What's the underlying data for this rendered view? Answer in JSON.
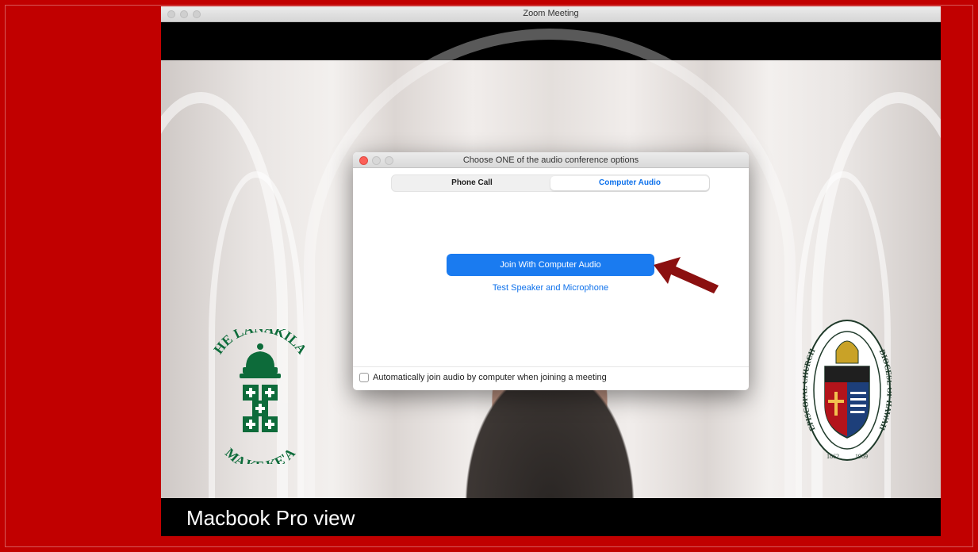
{
  "window": {
    "title": "Zoom Meeting"
  },
  "caption": "Macbook Pro view",
  "dialog": {
    "title": "Choose ONE of the audio conference options",
    "tabs": [
      {
        "label": "Phone Call",
        "selected": false
      },
      {
        "label": "Computer Audio",
        "selected": true
      }
    ],
    "join_button": "Join With Computer Audio",
    "test_link": "Test Speaker and Microphone",
    "auto_join_label": "Automatically join audio by computer when joining a meeting",
    "auto_join_checked": false
  },
  "logo_left": {
    "top_text": "HE LANAKILA",
    "bottom_text": "MA KE KE'A",
    "color": "#0d6b3a"
  },
  "logo_right": {
    "left_text": "EPISCOPAL CHURCH",
    "right_text": "DIOCESE OF HAWAII",
    "year_left": "1862",
    "year_right": "1969"
  },
  "colors": {
    "slide_background": "#c10000",
    "accent_blue": "#1a7bf0",
    "arrow": "#8b1010"
  }
}
